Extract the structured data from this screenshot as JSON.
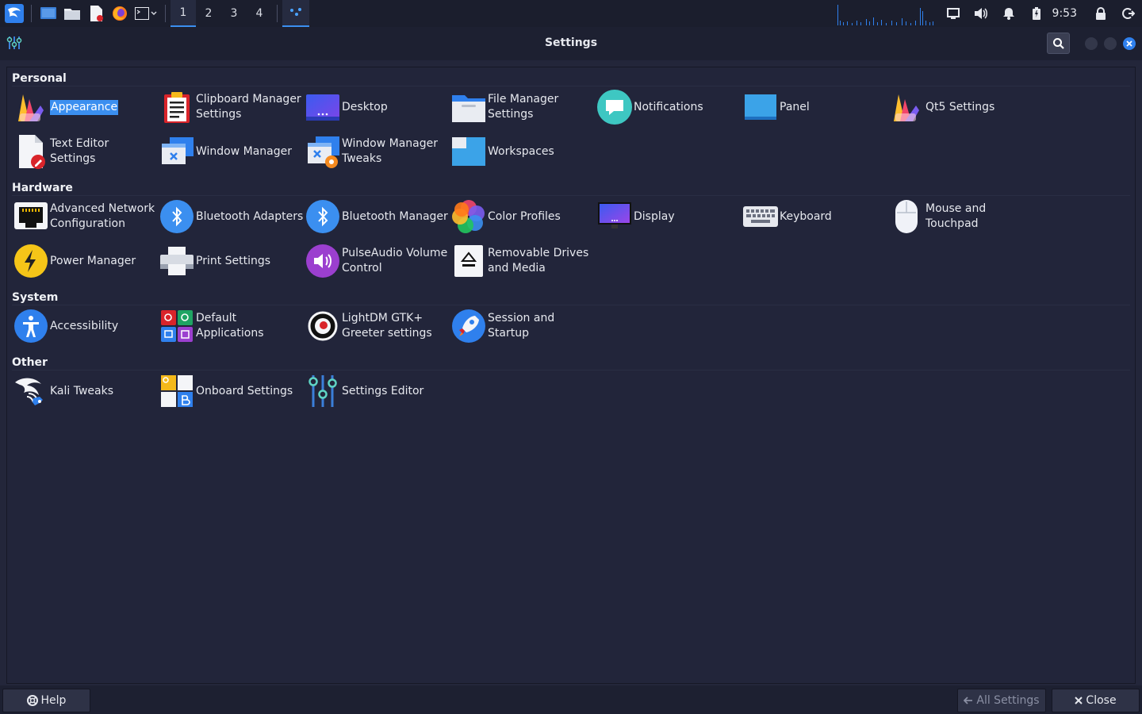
{
  "topbar": {
    "workspaces": [
      "1",
      "2",
      "3",
      "4"
    ],
    "clock": "9:53"
  },
  "window": {
    "title": "Settings"
  },
  "sections": [
    {
      "title": "Personal",
      "items": [
        {
          "label": "Appearance",
          "icon": "appearance-icon",
          "selected": true
        },
        {
          "label": "Clipboard Manager\nSettings",
          "icon": "clipboard-icon"
        },
        {
          "label": "Desktop",
          "icon": "desktop-icon"
        },
        {
          "label": "File Manager\nSettings",
          "icon": "folder-icon"
        },
        {
          "label": "Notifications",
          "icon": "notifications-icon"
        },
        {
          "label": "Panel",
          "icon": "panel-icon"
        },
        {
          "label": "Qt5 Settings",
          "icon": "qt5-icon"
        },
        {
          "label": "Text Editor Settings",
          "icon": "text-editor-icon"
        },
        {
          "label": "Window Manager",
          "icon": "window-manager-icon"
        },
        {
          "label": "Window Manager\nTweaks",
          "icon": "window-tweaks-icon"
        },
        {
          "label": "Workspaces",
          "icon": "workspaces-icon"
        }
      ]
    },
    {
      "title": "Hardware",
      "items": [
        {
          "label": "Advanced Network\nConfiguration",
          "icon": "network-icon"
        },
        {
          "label": "Bluetooth Adapters",
          "icon": "bluetooth-icon"
        },
        {
          "label": "Bluetooth Manager",
          "icon": "bluetooth-icon"
        },
        {
          "label": "Color Profiles",
          "icon": "color-profiles-icon"
        },
        {
          "label": "Display",
          "icon": "display-icon"
        },
        {
          "label": "Keyboard",
          "icon": "keyboard-icon"
        },
        {
          "label": "Mouse and\nTouchpad",
          "icon": "mouse-icon"
        },
        {
          "label": "Power Manager",
          "icon": "power-icon"
        },
        {
          "label": "Print Settings",
          "icon": "printer-icon"
        },
        {
          "label": "PulseAudio Volume\nControl",
          "icon": "volume-icon"
        },
        {
          "label": "Removable Drives\nand Media",
          "icon": "eject-icon"
        }
      ]
    },
    {
      "title": "System",
      "items": [
        {
          "label": "Accessibility",
          "icon": "accessibility-icon"
        },
        {
          "label": "Default\nApplications",
          "icon": "default-apps-icon"
        },
        {
          "label": "LightDM GTK+\nGreeter settings",
          "icon": "lightdm-icon"
        },
        {
          "label": "Session and Startup",
          "icon": "rocket-icon"
        }
      ]
    },
    {
      "title": "Other",
      "items": [
        {
          "label": "Kali Tweaks",
          "icon": "kali-dragon-icon"
        },
        {
          "label": "Onboard Settings",
          "icon": "onboard-icon"
        },
        {
          "label": "Settings Editor",
          "icon": "settings-editor-icon"
        }
      ]
    }
  ],
  "buttons": {
    "help": "Help",
    "all_settings": "All Settings",
    "close": "Close"
  },
  "colors": {
    "accent": "#3b8ff0",
    "background": "#22253a",
    "panel": "#1b1e2d"
  }
}
